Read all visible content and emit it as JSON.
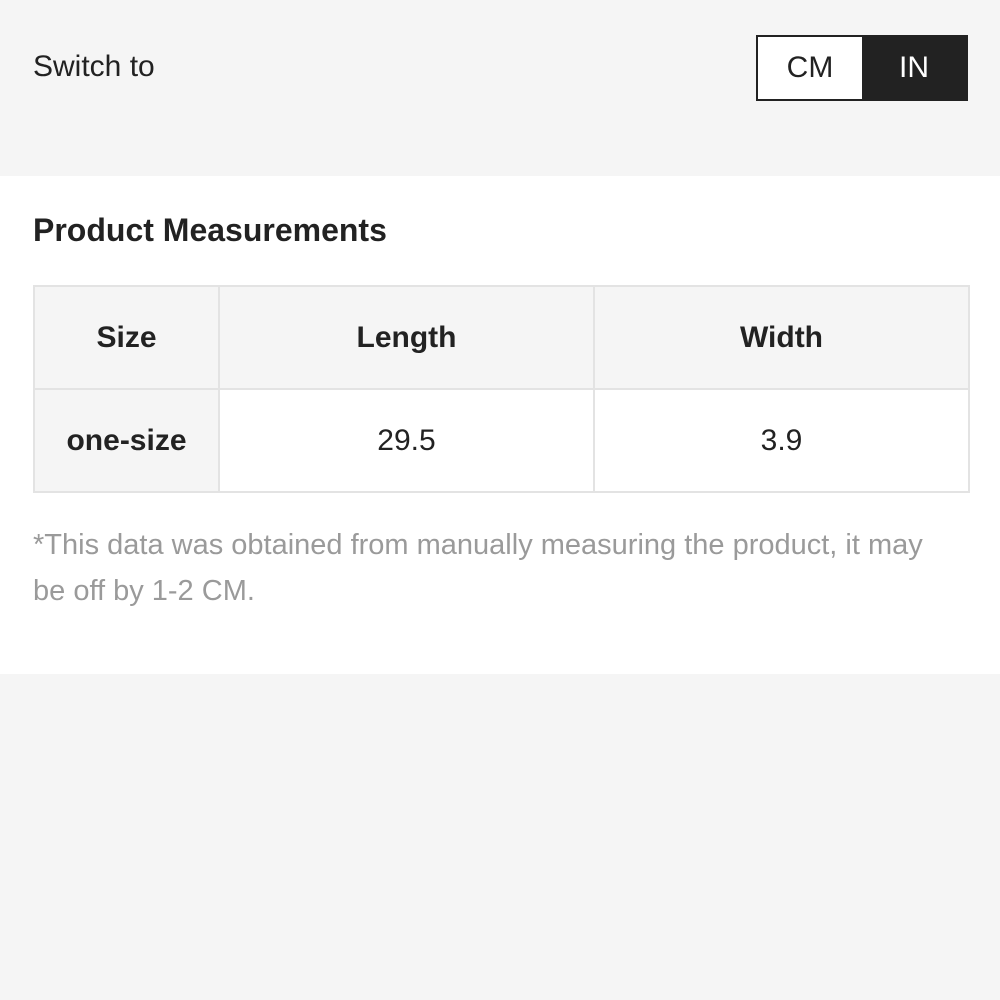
{
  "switcher": {
    "label": "Switch to",
    "options": [
      "CM",
      "IN"
    ],
    "selected": "IN"
  },
  "measurements": {
    "title": "Product Measurements",
    "columns": [
      "Size",
      "Length",
      "Width"
    ],
    "rows": [
      {
        "size": "one-size",
        "length": "29.5",
        "width": "3.9"
      }
    ],
    "note": "*This data was obtained from manually measuring the product, it may be off by 1-2 CM."
  },
  "colors": {
    "background": "#f5f5f5",
    "active_toggle": "#222222",
    "note_text": "#9a9a9a"
  }
}
